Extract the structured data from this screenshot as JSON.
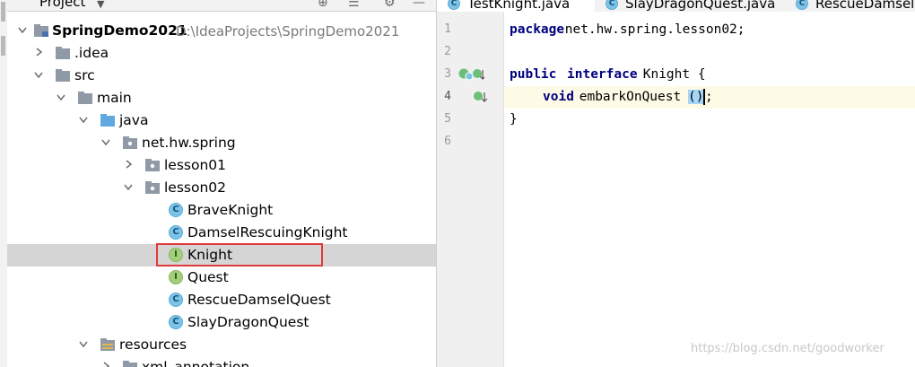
{
  "project_panel": {
    "title": "Project",
    "tree": [
      {
        "id": "root",
        "label": "SpringDemo2021",
        "path": "D:\\IdeaProjects\\SpringDemo2021",
        "type": "module",
        "expanded": true
      },
      {
        "id": "idea",
        "label": ".idea",
        "type": "folder",
        "expanded": false
      },
      {
        "id": "src",
        "label": "src",
        "type": "folder",
        "expanded": true
      },
      {
        "id": "main",
        "label": "main",
        "type": "folder",
        "expanded": true
      },
      {
        "id": "java",
        "label": "java",
        "type": "source-folder",
        "expanded": true
      },
      {
        "id": "pkg",
        "label": "net.hw.spring",
        "type": "package",
        "expanded": true
      },
      {
        "id": "lesson01",
        "label": "lesson01",
        "type": "package",
        "expanded": false
      },
      {
        "id": "lesson02",
        "label": "lesson02",
        "type": "package",
        "expanded": true
      },
      {
        "id": "braveknight",
        "label": "BraveKnight",
        "type": "class"
      },
      {
        "id": "damsel",
        "label": "DamselRescuingKnight",
        "type": "class"
      },
      {
        "id": "knight",
        "label": "Knight",
        "type": "interface",
        "selected": true
      },
      {
        "id": "quest",
        "label": "Quest",
        "type": "interface"
      },
      {
        "id": "rescue",
        "label": "RescueDamselQuest",
        "type": "class"
      },
      {
        "id": "slay",
        "label": "SlayDragonQuest",
        "type": "class"
      },
      {
        "id": "resources",
        "label": "resources",
        "type": "resources-folder",
        "expanded": true
      },
      {
        "id": "xml",
        "label": "xml_annotation",
        "type": "folder",
        "expanded": false
      }
    ]
  },
  "editor": {
    "tabs": [
      {
        "label": "TestKnight.java",
        "active": true
      },
      {
        "label": "SlayDragonQuest.java",
        "active": false
      },
      {
        "label": "RescueDamselQ",
        "active": false
      }
    ],
    "line_numbers": [
      "1",
      "2",
      "3",
      "4",
      "5",
      "6"
    ],
    "code": {
      "l1_kw": "package",
      "l1_rest": " net.hw.spring.lesson02;",
      "l3_kw1": "public",
      "l3_kw2": "interface",
      "l3_rest": " Knight {",
      "l4_kw": "void",
      "l4_name": " embarkOnQuest",
      "l4_paren": "()",
      "l4_end": ";",
      "l5": "}"
    }
  },
  "watermark": "https://blog.csdn.net/goodworker",
  "colors": {
    "class_icon": "#7bc4e8",
    "interface_icon": "#a3cf7c",
    "highlight_box": "#e03a3a",
    "keyword": "#000080",
    "selection": "#d5d5d5"
  }
}
